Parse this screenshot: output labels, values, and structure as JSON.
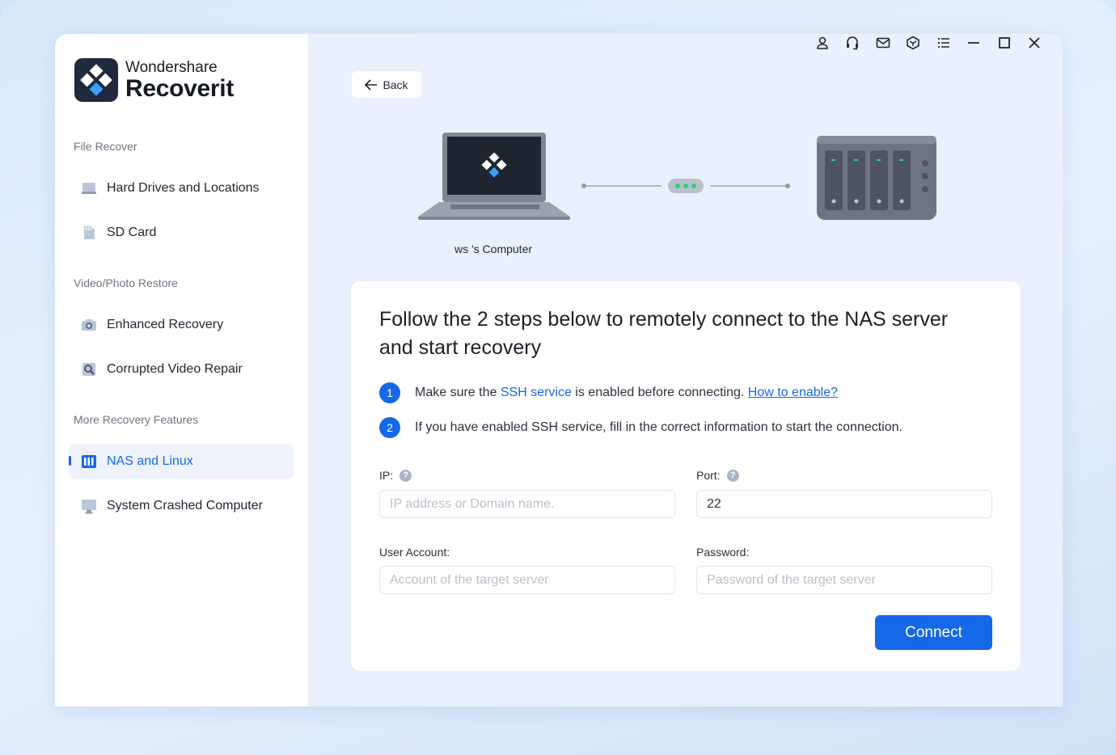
{
  "app": {
    "brand": "Wondershare",
    "product": "Recoverit"
  },
  "titlebar": {
    "icons": [
      "user-icon",
      "headset-icon",
      "mail-icon",
      "box-icon",
      "menu-list-icon",
      "minimize-icon",
      "maximize-icon",
      "close-icon"
    ]
  },
  "sidebar": {
    "sections": [
      {
        "label": "File Recover",
        "items": [
          {
            "label": "Hard Drives and Locations",
            "icon": "hard-drive-icon"
          },
          {
            "label": "SD Card",
            "icon": "sd-card-icon"
          }
        ]
      },
      {
        "label": "Video/Photo Restore",
        "items": [
          {
            "label": "Enhanced Recovery",
            "icon": "camera-icon"
          },
          {
            "label": "Corrupted Video Repair",
            "icon": "video-repair-icon"
          }
        ]
      },
      {
        "label": "More Recovery Features",
        "items": [
          {
            "label": "NAS and Linux",
            "icon": "nas-icon",
            "active": true
          },
          {
            "label": "System Crashed Computer",
            "icon": "monitor-icon"
          }
        ]
      }
    ]
  },
  "main": {
    "back_label": "Back",
    "computer_label": "ws 's Computer",
    "card": {
      "title": "Follow the 2 steps below to remotely connect to the NAS server and start recovery",
      "step1": {
        "num": "1",
        "before": "Make sure the ",
        "highlight": "SSH service",
        "after": " is enabled before connecting. ",
        "link": "How to enable?"
      },
      "step2": {
        "num": "2",
        "text": "If you have enabled SSH service, fill in the correct information to start the connection."
      },
      "ip": {
        "label": "IP:",
        "placeholder": "IP address or Domain name.",
        "value": ""
      },
      "port": {
        "label": "Port:",
        "value": "22"
      },
      "account": {
        "label": "User Account:",
        "placeholder": "Account of the target server",
        "value": ""
      },
      "password": {
        "label": "Password:",
        "placeholder": "Password of the target server",
        "value": ""
      },
      "connect_label": "Connect"
    }
  },
  "colors": {
    "accent": "#1568e8",
    "sidebar_bg": "#ffffff",
    "main_bg": "#e9f0fb",
    "status_green": "#2bd576"
  }
}
